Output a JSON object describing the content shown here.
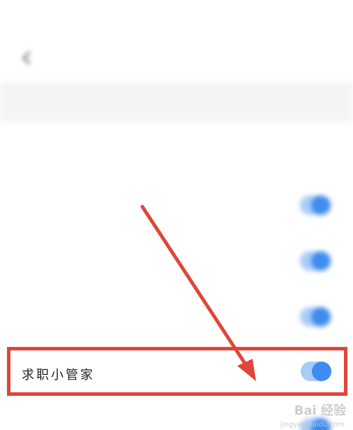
{
  "status_bar": {
    "left": "",
    "right": ""
  },
  "nav": {
    "title": ""
  },
  "section": {
    "header": ""
  },
  "rows": [
    {
      "label": "",
      "value": ""
    },
    {
      "label": "",
      "toggle_on": true
    },
    {
      "label": "",
      "toggle_on": true
    },
    {
      "label": "",
      "toggle_on": true
    }
  ],
  "highlighted_row": {
    "label": "求职小管家",
    "toggle_on": true
  },
  "bottom_row": {
    "label": "",
    "toggle_on": true
  },
  "watermark": {
    "text": "Bai 经验",
    "sub": "jingyan.baidu.com"
  },
  "colors": {
    "accent": "#3f8cf0",
    "highlight_border": "#e04538",
    "arrow": "#e04538"
  }
}
